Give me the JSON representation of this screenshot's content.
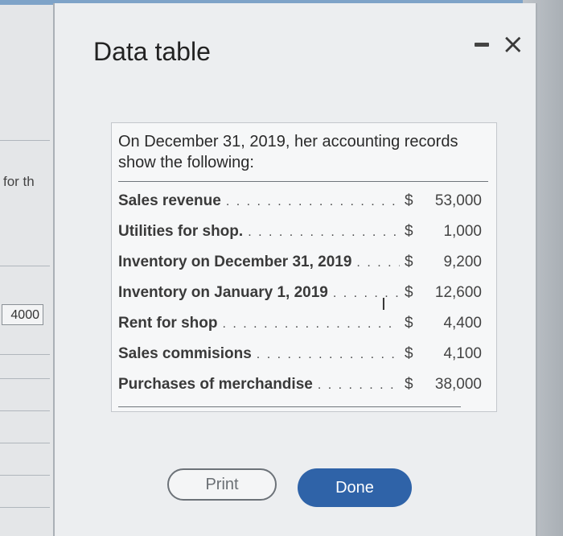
{
  "background": {
    "partial_text": "for th",
    "cell_value": "4000"
  },
  "dialog": {
    "title": "Data table",
    "minimize_label": "-",
    "close_label": "×"
  },
  "table": {
    "intro": "On December 31, 2019, her accounting records show the following:",
    "rows": [
      {
        "label": "Sales revenue",
        "currency": "$",
        "amount": "53,000"
      },
      {
        "label": "Utilities for shop.",
        "currency": "$",
        "amount": "1,000"
      },
      {
        "label": "Inventory on December 31, 2019",
        "currency": "$",
        "amount": "9,200"
      },
      {
        "label": "Inventory on January 1, 2019",
        "currency": "$",
        "amount": "12,600"
      },
      {
        "label": "Rent for shop",
        "currency": "$",
        "amount": "4,400"
      },
      {
        "label": "Sales commisions",
        "currency": "$",
        "amount": "4,100"
      },
      {
        "label": "Purchases of merchandise",
        "currency": "$",
        "amount": "38,000"
      }
    ]
  },
  "buttons": {
    "print_label": "Print",
    "done_label": "Done"
  },
  "colors": {
    "done_button": "#2f63a8",
    "dialog_bg": "#eceef0"
  },
  "icons": {
    "cursor": "text-cursor-icon"
  }
}
